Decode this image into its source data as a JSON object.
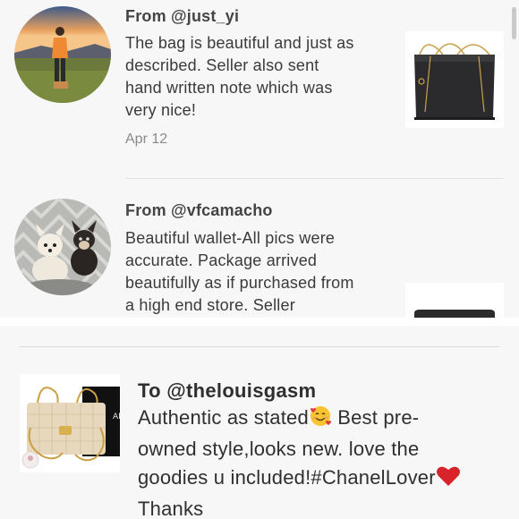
{
  "reviews": [
    {
      "from": "From @just_yi",
      "text_lines": [
        "The bag is beautiful and just as",
        "described. Seller also sent",
        "hand written note which was",
        "very nice!"
      ],
      "date": "Apr 12"
    },
    {
      "from": "From @vfcamacho",
      "text_lines": [
        "Beautiful wallet-All pics were",
        "accurate. Package arrived",
        "beautifully as if purchased from",
        "a high end store. Seller"
      ]
    }
  ],
  "highlight": {
    "title": "To @thelouisgasm",
    "lines": [
      "Authentic as stated",
      " Best pre-",
      "owned style,looks new. love the",
      "goodies u included!#ChanelLover",
      "Thanks"
    ],
    "emoji_face": "smiling-face-with-hearts",
    "emoji_heart": "red-heart",
    "photo_text": "AN"
  },
  "colors": {
    "panel_bg": "#f7f7f7",
    "heart": "#d8232a",
    "emoji_yellow": "#f6c431"
  }
}
